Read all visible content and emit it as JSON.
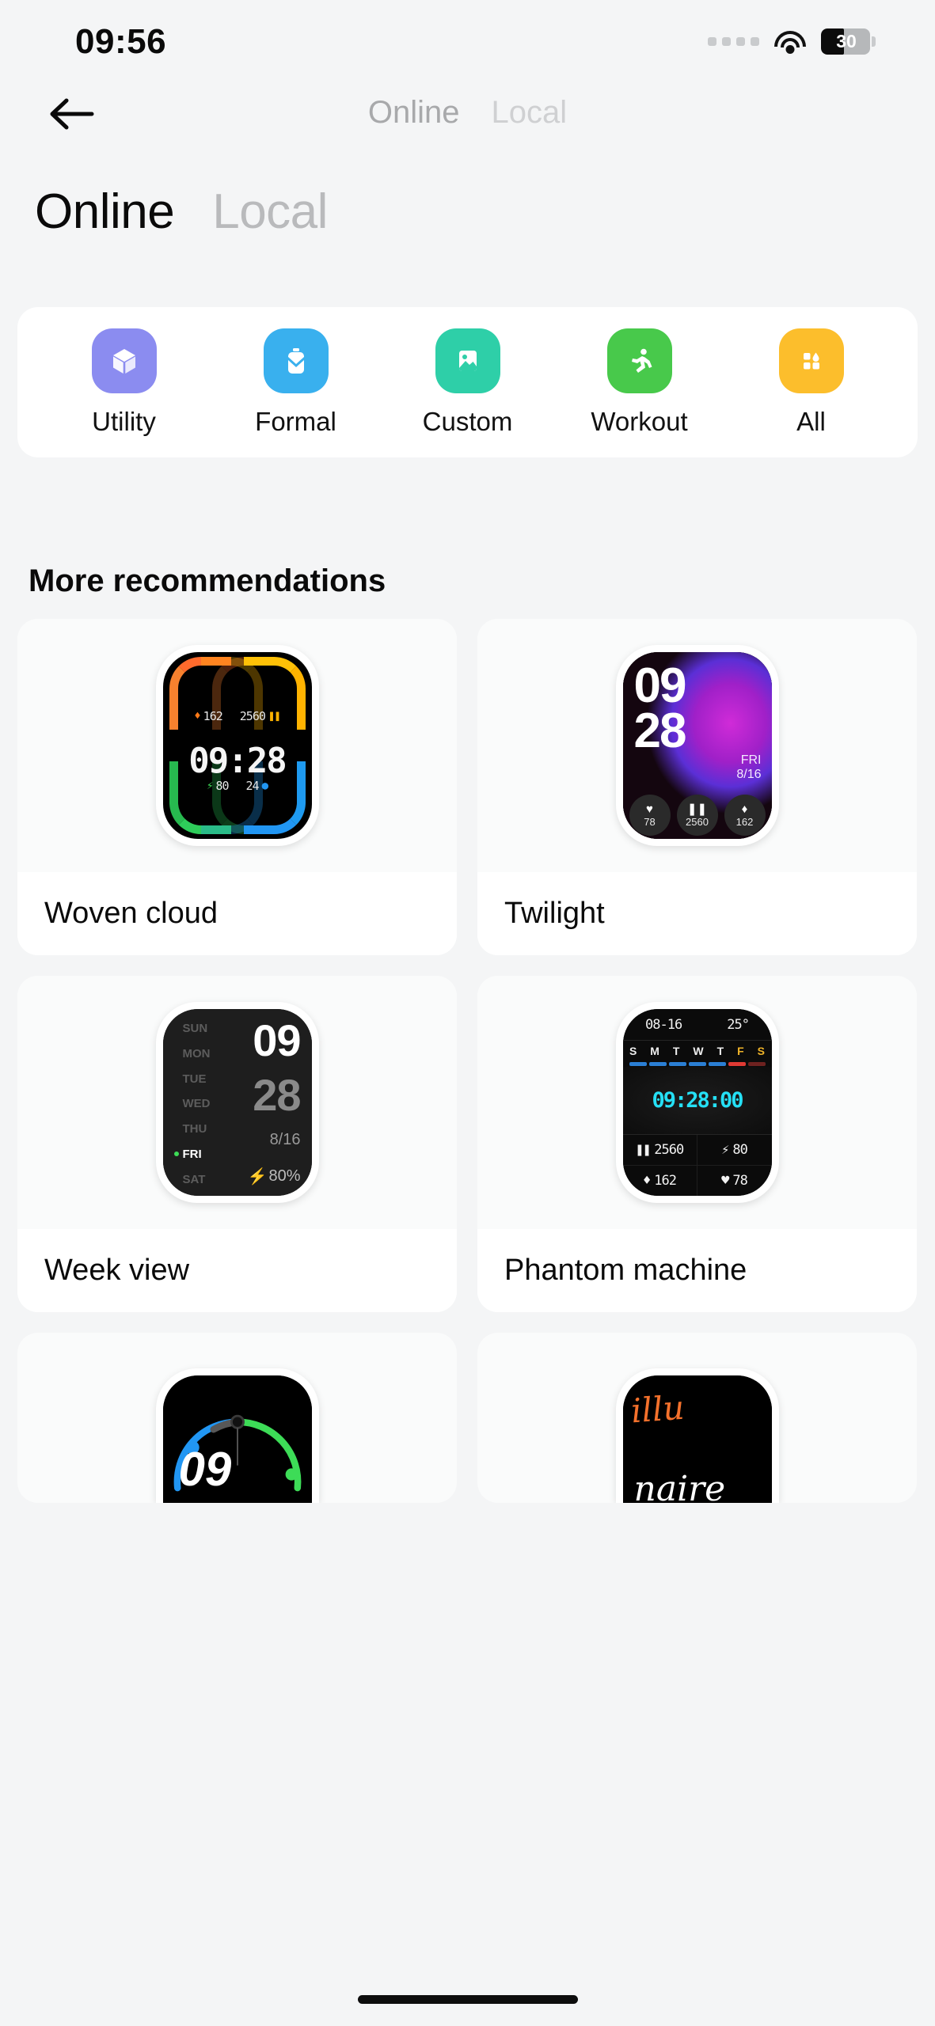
{
  "status_bar": {
    "time": "09:56",
    "battery_percent": "30",
    "wifi_icon": "wifi-icon",
    "signal_dots_icon": "signal-dots-icon"
  },
  "nav": {
    "back_icon": "back-arrow-icon",
    "small_tabs": [
      {
        "label": "Online",
        "active": true
      },
      {
        "label": "Local",
        "active": false
      }
    ]
  },
  "header": {
    "tabs": [
      {
        "label": "Online",
        "active": true
      },
      {
        "label": "Local",
        "active": false
      }
    ]
  },
  "categories": [
    {
      "label": "Utility",
      "icon": "cube-icon",
      "color": "#8b8cf0"
    },
    {
      "label": "Formal",
      "icon": "watch-band-icon",
      "color": "#39b0ee"
    },
    {
      "label": "Custom",
      "icon": "image-icon",
      "color": "#2ecfa8"
    },
    {
      "label": "Workout",
      "icon": "runner-icon",
      "color": "#48c94b"
    },
    {
      "label": "All",
      "icon": "grid-icon",
      "color": "#fcbe2c"
    }
  ],
  "section": {
    "title": "More recommendations"
  },
  "faces": [
    {
      "name": "Woven cloud",
      "style": "woven-cloud",
      "time": "09:28",
      "metrics": {
        "calories": "162",
        "steps": "2560",
        "battery": "80",
        "hours": "24"
      },
      "arc_colors": {
        "top_left": "#ff6a2c",
        "top_right": "#ffc107",
        "bottom_left": "#2ecc5a",
        "bottom_right": "#2196f3"
      }
    },
    {
      "name": "Twilight",
      "style": "twilight",
      "hours": "09",
      "minutes": "28",
      "weekday": "FRI",
      "date": "8/16",
      "widgets": [
        {
          "icon": "heart-icon",
          "glyph": "♥",
          "value": "78"
        },
        {
          "icon": "steps-icon",
          "glyph": "❙❙",
          "value": "2560"
        },
        {
          "icon": "flame-icon",
          "glyph": "◆",
          "value": "162"
        }
      ]
    },
    {
      "name": "Week view",
      "style": "week-view",
      "days": [
        "SUN",
        "MON",
        "TUE",
        "WED",
        "THU",
        "FRI",
        "SAT"
      ],
      "active_day": "FRI",
      "hours": "09",
      "minutes": "28",
      "date": "8/16",
      "battery": "80%"
    },
    {
      "name": "Phantom machine",
      "style": "phantom-machine",
      "date": "08-16",
      "temperature": "25°",
      "day_letters": [
        "S",
        "M",
        "T",
        "W",
        "T",
        "F",
        "S"
      ],
      "weekend_indices": [
        5,
        6
      ],
      "time": "09:28:00",
      "stats": [
        {
          "icon": "steps-icon",
          "glyph": "❙❙",
          "value": "2560"
        },
        {
          "icon": "bolt-icon",
          "glyph": "⚡",
          "value": "80"
        },
        {
          "icon": "flame-icon",
          "glyph": "◆",
          "value": "162"
        },
        {
          "icon": "heart-icon",
          "glyph": "♥",
          "value": "78"
        }
      ]
    },
    {
      "name": "",
      "style": "partial-gauge",
      "hours": "09"
    },
    {
      "name": "",
      "style": "partial-script",
      "line1": "illu",
      "line2": "naire"
    }
  ]
}
